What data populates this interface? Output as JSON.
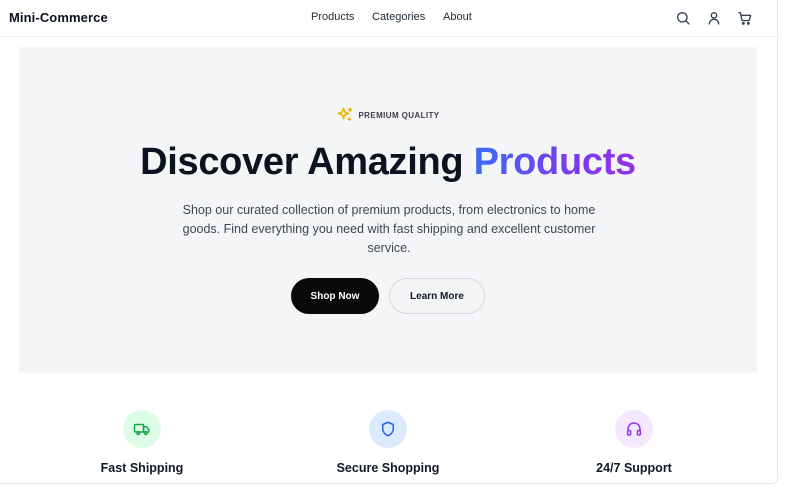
{
  "header": {
    "brand": "Mini-Commerce",
    "nav": [
      {
        "label": "Products"
      },
      {
        "label": "Categories"
      },
      {
        "label": "About"
      }
    ],
    "icons": [
      "search-icon",
      "user-icon",
      "cart-icon"
    ]
  },
  "hero": {
    "badge_text": "PREMIUM QUALITY",
    "badge_icon": "sparkles-icon",
    "headline_main": "Discover Amazing ",
    "headline_accent": "Products",
    "subtext": "Shop our curated collection of premium products, from electronics to home goods. Find everything you need with fast shipping and excellent customer service.",
    "primary_button": "Shop Now",
    "secondary_button": "Learn More",
    "colors": {
      "accent_start": "#3b6cf5",
      "accent_end": "#9333ea",
      "badge_icon": "#eab308"
    }
  },
  "features": [
    {
      "label": "Fast Shipping",
      "icon": "truck-icon",
      "color": "#16a34a"
    },
    {
      "label": "Secure Shopping",
      "icon": "shield-icon",
      "color": "#2563eb"
    },
    {
      "label": "24/7 Support",
      "icon": "headphones-icon",
      "color": "#9333ea"
    }
  ]
}
